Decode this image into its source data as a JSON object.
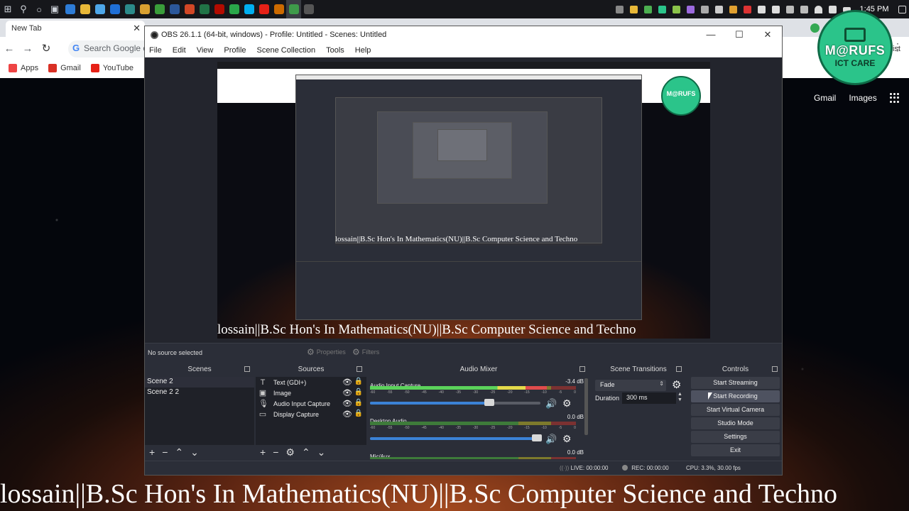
{
  "taskbar": {
    "search_icon": "search-icon",
    "cortana_icon": "cortana-icon",
    "taskview_icon": "task-view-icon",
    "apps": [
      {
        "name": "app-1",
        "color": "#2d7cd6"
      },
      {
        "name": "chrome",
        "color": "#e8b838"
      },
      {
        "name": "app-3",
        "color": "#4da6e8"
      },
      {
        "name": "app-4",
        "color": "#1f6fd6"
      },
      {
        "name": "app-5",
        "color": "#2b8a8a"
      },
      {
        "name": "app-6",
        "color": "#d9a030"
      },
      {
        "name": "app-7",
        "color": "#3a9d3a"
      },
      {
        "name": "word",
        "color": "#2b579a"
      },
      {
        "name": "powerpoint",
        "color": "#d24726"
      },
      {
        "name": "excel",
        "color": "#217346"
      },
      {
        "name": "acrobat",
        "color": "#b30b00"
      },
      {
        "name": "app-12",
        "color": "#2aa84a"
      },
      {
        "name": "skype",
        "color": "#00aff0"
      },
      {
        "name": "youtube",
        "color": "#e62117"
      },
      {
        "name": "illustrator",
        "color": "#cc6a00"
      },
      {
        "name": "chrome-2",
        "color": "#3e9b4a"
      },
      {
        "name": "obs",
        "color": "#555555"
      }
    ],
    "clock": "1:45 PM"
  },
  "browser": {
    "tab_title": "New Tab",
    "omnibox_placeholder": "Search Google o",
    "bookmarks": [
      {
        "label": "Apps",
        "color": "#e44"
      },
      {
        "label": "Gmail",
        "color": "#d93025"
      },
      {
        "label": "YouTube",
        "color": "#e62117"
      }
    ],
    "reading_list": "g list",
    "google_links": [
      "Gmail",
      "Images"
    ]
  },
  "logo": {
    "line1": "M@RUFS",
    "line2": "ICT CARE"
  },
  "obs": {
    "title": "OBS 26.1.1 (64-bit, windows) - Profile: Untitled - Scenes: Untitled",
    "menu": [
      "File",
      "Edit",
      "View",
      "Profile",
      "Scene Collection",
      "Tools",
      "Help"
    ],
    "ticker_text": "lossain||B.Sc Hon's In Mathematics(NU)||B.Sc Computer Science and Techno",
    "nested_ticker": "lossain||B.Sc Hon's In Mathematics(NU)||B.Sc Computer Science and Techno",
    "no_source": "No source selected",
    "properties_label": "Properties",
    "filters_label": "Filters",
    "docks": {
      "scenes": "Scenes",
      "sources": "Sources",
      "mixer": "Audio Mixer",
      "transitions": "Scene Transitions",
      "controls": "Controls"
    },
    "scenes": [
      "Scene 2",
      "Scene 2 2"
    ],
    "sources": [
      {
        "label": "Text (GDI+)",
        "icon": "T"
      },
      {
        "label": "Image",
        "icon": "▣"
      },
      {
        "label": "Audio Input Capture",
        "icon": "🎙"
      },
      {
        "label": "Display Capture",
        "icon": "▭"
      }
    ],
    "mixer": [
      {
        "name": "Audio Input Capture",
        "db": "-3.4 dB",
        "level": 0.86,
        "volume": 0.72
      },
      {
        "name": "Desktop Audio",
        "db": "0.0 dB",
        "level": 0.0,
        "volume": 1.0
      },
      {
        "name": "Mic/Aux",
        "db": "0.0 dB",
        "level": 0.0,
        "volume": 1.0
      }
    ],
    "meter_ticks": [
      "-60",
      "-55",
      "-50",
      "-45",
      "-40",
      "-35",
      "-30",
      "-25",
      "-20",
      "-15",
      "-10",
      "-5",
      "0"
    ],
    "transition": "Fade",
    "duration_label": "Duration",
    "duration_value": "300 ms",
    "controls": [
      "Start Streaming",
      "Start Recording",
      "Start Virtual Camera",
      "Studio Mode",
      "Settings",
      "Exit"
    ],
    "status": {
      "live": "LIVE: 00:00:00",
      "rec": "REC: 00:00:00",
      "cpu": "CPU: 3.3%, 30.00 fps"
    }
  }
}
